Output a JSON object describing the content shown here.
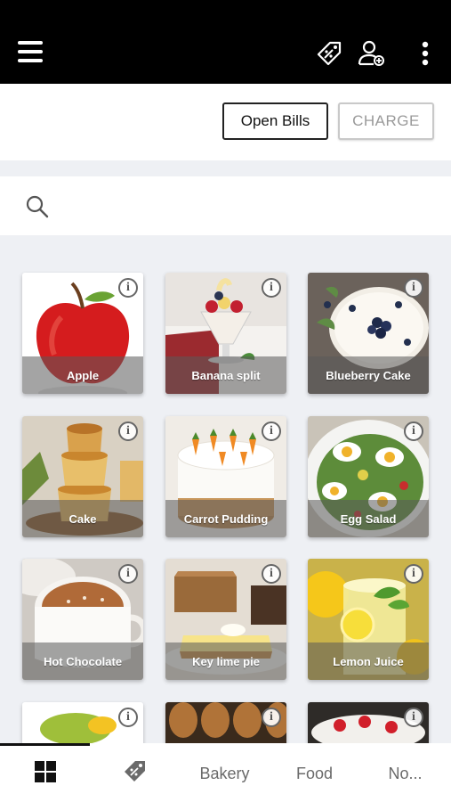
{
  "actions": {
    "open_bills": "Open Bills",
    "charge": "CHARGE"
  },
  "search": {
    "placeholder": ""
  },
  "items": [
    {
      "name": "Apple"
    },
    {
      "name": "Banana split"
    },
    {
      "name": "Blueberry Cake"
    },
    {
      "name": "Cake"
    },
    {
      "name": "Carrot Pudding"
    },
    {
      "name": "Egg Salad"
    },
    {
      "name": "Hot Chocolate"
    },
    {
      "name": "Key lime pie"
    },
    {
      "name": "Lemon Juice"
    }
  ],
  "tabs": {
    "bakery": "Bakery",
    "food": "Food",
    "more": "No..."
  },
  "icons": {
    "menu": "hamburger-menu-icon",
    "discounts": "price-tag-icon",
    "customer": "add-customer-icon",
    "overflow": "more-vertical-icon",
    "search": "search-icon",
    "info": "info-icon"
  },
  "colors": {
    "topbar": "#000000",
    "background": "#eef0f4",
    "charge_text": "#9a9a9a"
  }
}
